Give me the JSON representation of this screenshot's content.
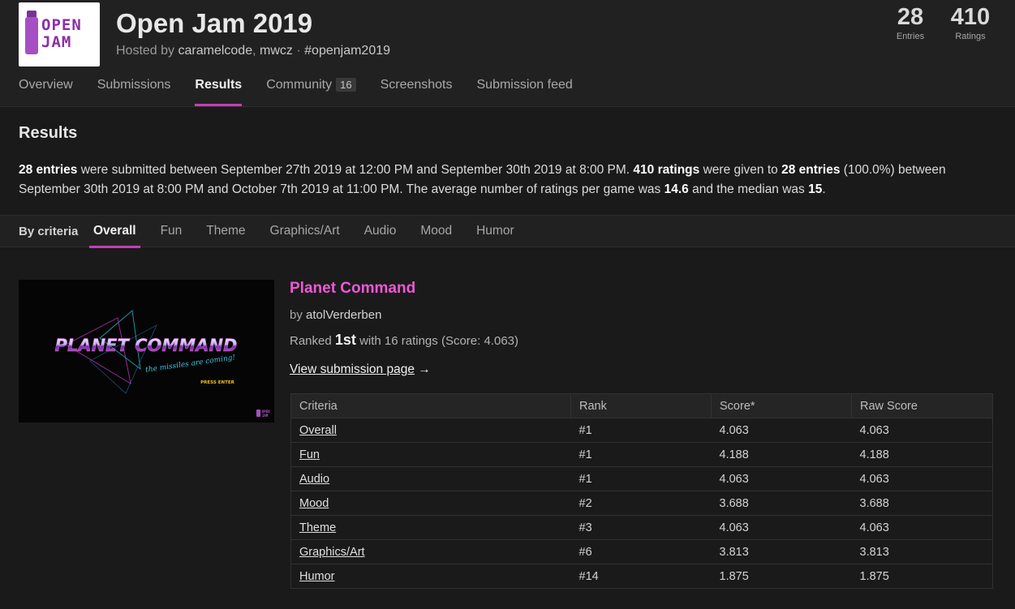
{
  "jam": {
    "logo_line1": "OPEN",
    "logo_line2": "JAM",
    "title": "Open Jam 2019",
    "hosted_prefix": "Hosted by",
    "host1": "caramelcode",
    "host_sep": ",",
    "host2": "mwcz",
    "dot": "·",
    "hashtag": "#openjam2019"
  },
  "stats": {
    "entries_value": "28",
    "entries_label": "Entries",
    "ratings_value": "410",
    "ratings_label": "Ratings"
  },
  "tabs": [
    {
      "label": "Overview"
    },
    {
      "label": "Submissions"
    },
    {
      "label": "Results",
      "active": true
    },
    {
      "label": "Community",
      "badge": "16"
    },
    {
      "label": "Screenshots"
    },
    {
      "label": "Submission feed"
    }
  ],
  "results": {
    "heading": "Results",
    "s1": "28 entries",
    "s2": " were submitted between September 27th 2019 at 12:00 PM and September 30th 2019 at 8:00 PM. ",
    "s3": "410 ratings",
    "s4": " were given to ",
    "s5": "28 entries",
    "s6": " (100.0%) between September 30th 2019 at 8:00 PM and October 7th 2019 at 11:00 PM. The average number of ratings per game was ",
    "s7": "14.6",
    "s8": " and the median was ",
    "s9": "15",
    "s10": "."
  },
  "criteria_bar": {
    "label": "By criteria",
    "tabs": [
      "Overall",
      "Fun",
      "Theme",
      "Graphics/Art",
      "Audio",
      "Mood",
      "Humor"
    ],
    "active": "Overall"
  },
  "entry": {
    "thumb_title": "PLANET COMMAND",
    "thumb_subtitle": "the missiles are coming!",
    "thumb_press": "PRESS ENTER",
    "thumb_logo1": "OPEN",
    "thumb_logo2": "JAM",
    "title": "Planet Command",
    "by_prefix": "by",
    "author": "atolVerderben",
    "ranked_prefix": "Ranked",
    "place": "1st",
    "ranked_suffix": "with 16 ratings (Score: 4.063)",
    "view_link": "View submission page",
    "view_arrow": "→"
  },
  "score_table": {
    "headers": [
      "Criteria",
      "Rank",
      "Score*",
      "Raw Score"
    ],
    "rows": [
      {
        "criteria": "Overall",
        "rank": "#1",
        "score": "4.063",
        "raw": "4.063"
      },
      {
        "criteria": "Fun",
        "rank": "#1",
        "score": "4.188",
        "raw": "4.188"
      },
      {
        "criteria": "Audio",
        "rank": "#1",
        "score": "4.063",
        "raw": "4.063"
      },
      {
        "criteria": "Mood",
        "rank": "#2",
        "score": "3.688",
        "raw": "3.688"
      },
      {
        "criteria": "Theme",
        "rank": "#3",
        "score": "4.063",
        "raw": "4.063"
      },
      {
        "criteria": "Graphics/Art",
        "rank": "#6",
        "score": "3.813",
        "raw": "3.813"
      },
      {
        "criteria": "Humor",
        "rank": "#14",
        "score": "1.875",
        "raw": "1.875"
      }
    ]
  },
  "colors": {
    "accent": "#c33fb5",
    "entry_title": "#ee58d8",
    "background": "#1b1a1a"
  }
}
